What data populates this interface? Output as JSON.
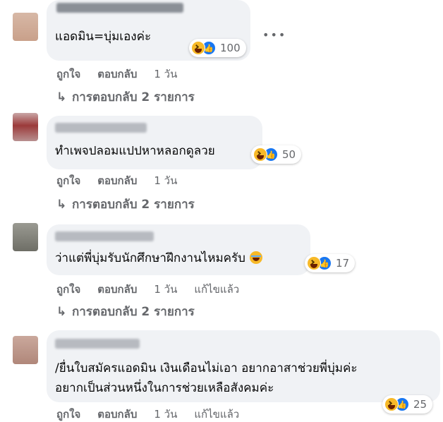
{
  "comments": [
    {
      "text": "แอดมิน=บุ่มเองค่ะ",
      "reaction_count": "100",
      "actions": {
        "like": "ถูกใจ",
        "reply": "ตอบกลับ",
        "time": "1 วัน"
      },
      "replies": "การตอบกลับ 2 รายการ",
      "more": "•••"
    },
    {
      "text": "ทำเพจปลอมแปปหาหลอกดูลวย",
      "reaction_count": "50",
      "actions": {
        "like": "ถูกใจ",
        "reply": "ตอบกลับ",
        "time": "1 วัน"
      },
      "replies": "การตอบกลับ 2 รายการ"
    },
    {
      "text": "ว่าแต่พี่บุ่มรับนักศึกษาฝึกงานไหมครับ",
      "reaction_count": "17",
      "actions": {
        "like": "ถูกใจ",
        "reply": "ตอบกลับ",
        "time": "1 วัน",
        "edited": "แก้ไขแล้ว"
      },
      "replies": "การตอบกลับ 2 รายการ"
    },
    {
      "text_line1": "/ยื่นใบสมัครแอดมิน เงินเดือนไม่เอา อยากอาสาช่วยพี่บุ่มค่ะ",
      "text_line2": "อยากเป็นส่วนหนึ่งในการช่วยเหลือสังคมค่ะ",
      "reaction_count": "25",
      "actions": {
        "like": "ถูกใจ",
        "reply": "ตอบกลับ",
        "time": "1 วัน",
        "edited": "แก้ไขแล้ว"
      }
    }
  ],
  "icons": {
    "haha": "haha-reaction-icon",
    "like": "like-reaction-icon",
    "reply_arrow": "reply-arrow-icon"
  },
  "colors": {
    "bubble": "#f0f2f5",
    "like_blue": "#1877f2",
    "haha_yellow": "#f7b928",
    "secondary_text": "#65676b"
  }
}
